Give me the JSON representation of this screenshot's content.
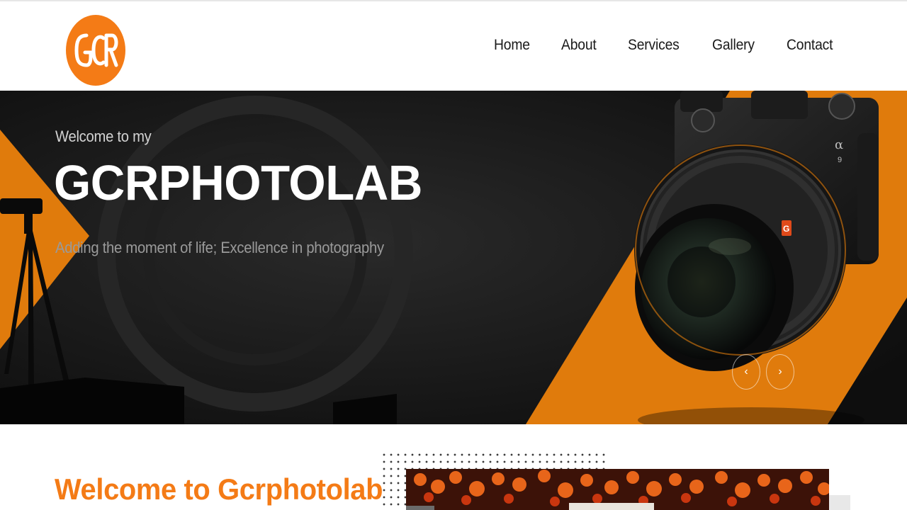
{
  "brand": {
    "logo_text": "GCR",
    "accent_color": "#f47b16"
  },
  "nav": {
    "items": [
      {
        "label": "Home"
      },
      {
        "label": "About"
      },
      {
        "label": "Services"
      },
      {
        "label": "Gallery"
      },
      {
        "label": "Contact"
      }
    ]
  },
  "hero": {
    "welcome": "Welcome to my",
    "title": "GCRPHOTOLAB",
    "subtitle": "Adding the moment of life; Excellence in photography",
    "prev_icon": "chevron-left-icon",
    "next_icon": "chevron-right-icon",
    "prev_glyph": "‹",
    "next_glyph": "›",
    "camera_badge_alpha": "α",
    "camera_badge_model": "9",
    "lens_badge": "G"
  },
  "about": {
    "title": "Welcome to Gcrphotolab"
  }
}
